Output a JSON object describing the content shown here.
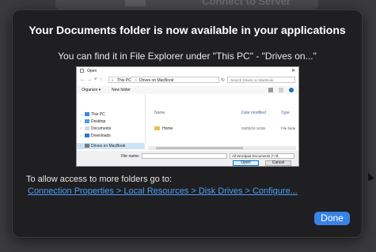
{
  "backdrop": {
    "title": "Connect to Server"
  },
  "dialog": {
    "title": "Your Documents folder is now available in your applications",
    "subtitle": "You can find it in File Explorer under \"This PC\" - \"Drives on...\"",
    "access_text": "To allow access to more folders go to:",
    "access_link": "Connection Properties > Local Resources > Disk Drives > Configure...",
    "done_label": "Done"
  },
  "explorer": {
    "window_title": "Open",
    "breadcrumb": [
      "This PC",
      "Drives on MacBook"
    ],
    "search_placeholder": "Search Drives on MacBook",
    "toolbar": {
      "organize": "Organize ▾",
      "new_folder": "New folder"
    },
    "tree": [
      {
        "label": "This PC",
        "chevron": "⌄"
      },
      {
        "label": "Desktop",
        "chevron": "›"
      },
      {
        "label": "Documents",
        "chevron": "›"
      },
      {
        "label": "Downloads",
        "chevron": "›"
      },
      {
        "label": "Drives on MacBook",
        "chevron": "›"
      }
    ],
    "columns": {
      "name": "Name",
      "date": "Date modified",
      "type": "Type"
    },
    "files": [
      {
        "name": "Home",
        "date": "04/02/19 18:56",
        "type": "File folde"
      }
    ],
    "file_name_label": "File name:",
    "filter": "All Wordpad Documents (*.rtf,",
    "open_label": "Open",
    "cancel_label": "Cancel"
  }
}
